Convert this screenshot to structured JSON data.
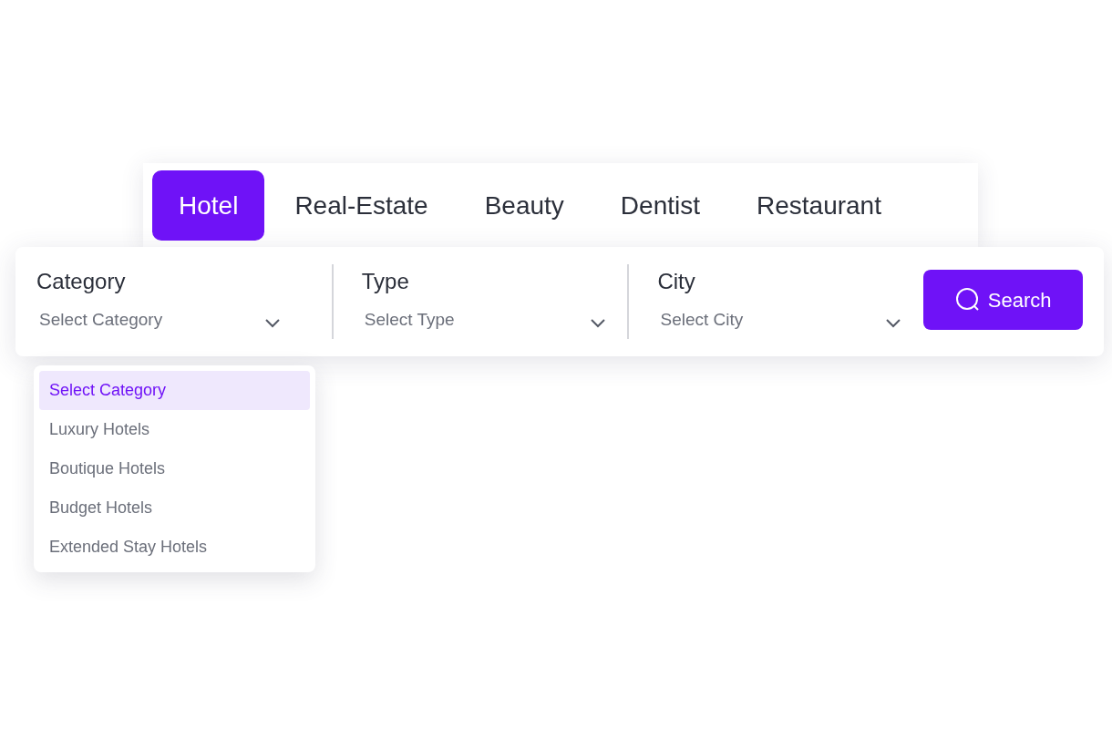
{
  "tabs": [
    {
      "label": "Hotel",
      "selected": true
    },
    {
      "label": "Real-Estate",
      "selected": false
    },
    {
      "label": "Beauty",
      "selected": false
    },
    {
      "label": "Dentist",
      "selected": false
    },
    {
      "label": "Restaurant",
      "selected": false
    }
  ],
  "fields": [
    {
      "label": "Category",
      "value": "Select Category",
      "options": [
        {
          "label": "Select Category",
          "selected": true
        },
        {
          "label": "Luxury Hotels",
          "selected": false
        },
        {
          "label": "Boutique Hotels",
          "selected": false
        },
        {
          "label": "Budget Hotels",
          "selected": false
        },
        {
          "label": "Extended Stay Hotels",
          "selected": false
        }
      ]
    },
    {
      "label": "Type",
      "value": "Select Type"
    },
    {
      "label": "City",
      "value": "Select City"
    }
  ],
  "search_button": {
    "label": "Search"
  }
}
